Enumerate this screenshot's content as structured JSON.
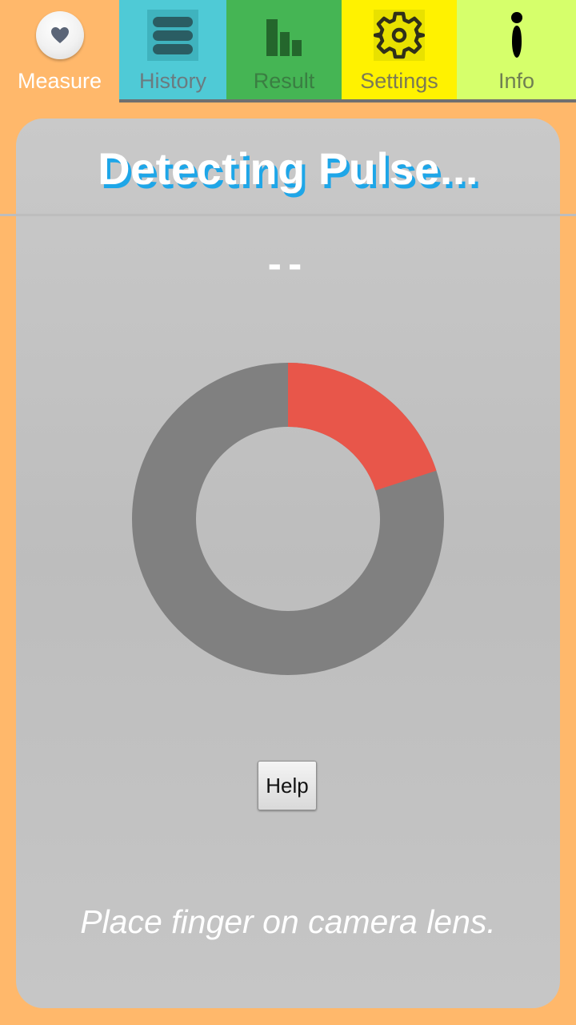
{
  "tabs": [
    {
      "id": "measure",
      "label": "Measure",
      "icon": "heart-icon",
      "color": "#ffb86b",
      "selected": true
    },
    {
      "id": "history",
      "label": "History",
      "icon": "list-icon",
      "color": "#4fcad6"
    },
    {
      "id": "result",
      "label": "Result",
      "icon": "bar-chart-icon",
      "color": "#45b554"
    },
    {
      "id": "settings",
      "label": "Settings",
      "icon": "gear-icon",
      "color": "#fff200"
    },
    {
      "id": "info",
      "label": "Info",
      "icon": "info-icon",
      "color": "#d6ff6b"
    }
  ],
  "main": {
    "title": "Detecting Pulse...",
    "pulse_value": "--",
    "progress": 0.2,
    "progress_color": "#e8564a",
    "track_color": "#808080",
    "help_label": "Help",
    "instruction": "Place finger on camera lens."
  },
  "colors": {
    "background": "#ffb86b",
    "title_shadow": "#1ea6e8"
  }
}
